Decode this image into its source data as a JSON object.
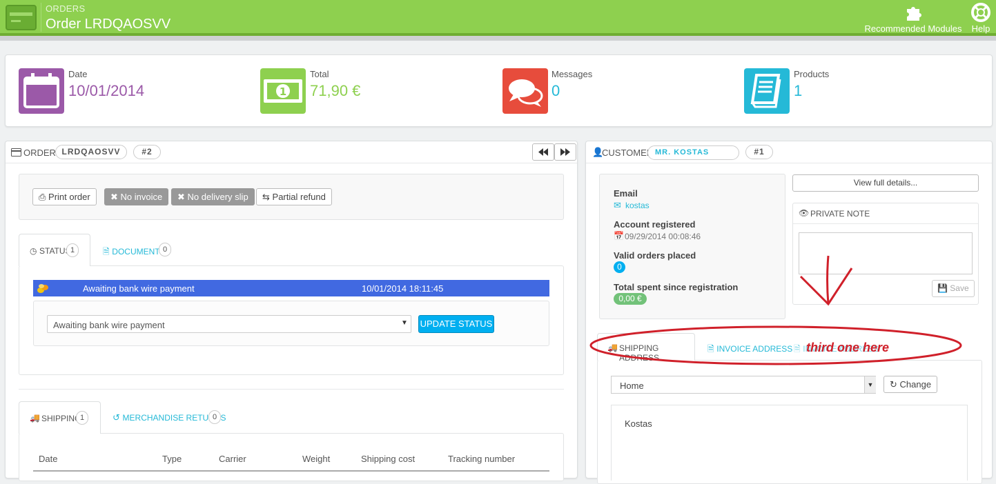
{
  "header": {
    "breadcrumb": "ORDERS",
    "title": "Order LRDQAOSVV",
    "modules_label": "Recommended Modules",
    "help_label": "Help"
  },
  "kpis": [
    {
      "label": "Date",
      "value": "10/01/2014",
      "color": "#9b59a8"
    },
    {
      "label": "Total",
      "value": "71,90 €",
      "color": "#8ed04f"
    },
    {
      "label": "Messages",
      "value": "0",
      "color": "#25b9d7"
    },
    {
      "label": "Products",
      "value": "1",
      "color": "#25b9d7"
    }
  ],
  "order": {
    "section_label": "ORDER",
    "reference": "LRDQAOSVV",
    "number": "#2",
    "buttons": {
      "print": "Print order",
      "no_invoice": "No invoice",
      "no_delivery": "No delivery slip",
      "partial_refund": "Partial refund"
    },
    "tabs": {
      "status_label": "STATUS",
      "status_count": "1",
      "documents_label": "DOCUMENTS",
      "documents_count": "0"
    },
    "status_row": {
      "name": "Awaiting bank wire payment",
      "date": "10/01/2014 18:11:45"
    },
    "status_select": "Awaiting bank wire payment",
    "update_button": "UPDATE STATUS",
    "shipping_tabs": {
      "shipping_label": "SHIPPING",
      "shipping_count": "1",
      "returns_label": "MERCHANDISE RETURNS",
      "returns_count": "0"
    },
    "shipping_columns": [
      "Date",
      "Type",
      "Carrier",
      "Weight",
      "Shipping cost",
      "Tracking number"
    ]
  },
  "customer": {
    "section_label": "CUSTOMER",
    "name": "MR. KOSTAS",
    "number": "#1",
    "email_label": "Email",
    "email": "kostas",
    "registered_label": "Account registered",
    "registered": "09/29/2014 00:08:46",
    "valid_orders_label": "Valid orders placed",
    "valid_orders": "0",
    "total_spent_label": "Total spent since registration",
    "total_spent": "0,00 €",
    "view_details": "View full details...",
    "private_note_label": "PRIVATE NOTE",
    "save_label": "Save",
    "address_tabs": {
      "shipping": "SHIPPING ADDRESS",
      "invoice": "INVOICE ADDRESS",
      "third": "INVOICE ADDRESS"
    },
    "annotation": "third one here",
    "address_select": "Home",
    "change_button": "Change",
    "address_name": "Kostas"
  },
  "colors": {
    "accent": "#25b9d7",
    "header": "#8ed04f",
    "annotation": "#d0202a"
  }
}
